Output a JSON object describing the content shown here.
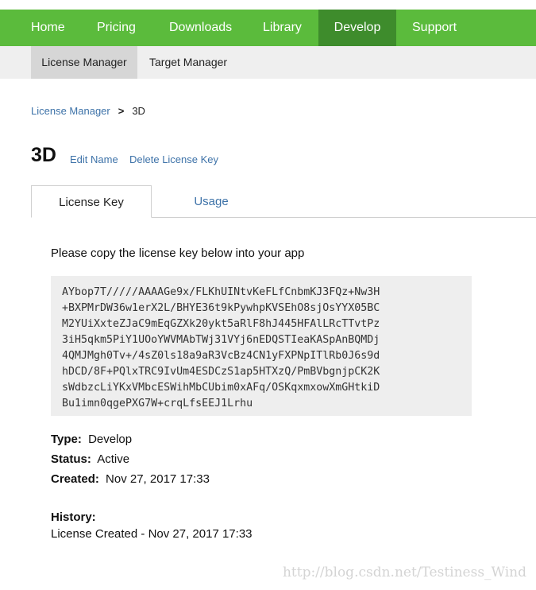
{
  "top_nav": {
    "items": [
      "Home",
      "Pricing",
      "Downloads",
      "Library",
      "Develop",
      "Support"
    ],
    "active": "Develop"
  },
  "sub_nav": {
    "items": [
      "License Manager",
      "Target Manager"
    ],
    "active": "License Manager"
  },
  "breadcrumb": {
    "parent": "License Manager",
    "separator": ">",
    "current": "3D"
  },
  "license": {
    "name": "3D",
    "edit_label": "Edit Name",
    "delete_label": "Delete License Key"
  },
  "tabs": [
    "License Key",
    "Usage"
  ],
  "key_section": {
    "instruction": "Please copy the license key below into your app",
    "key_lines": [
      "AYbop7T/////AAAAGe9x/FLKhUINtvKeFLfCnbmKJ3FQz+Nw3H",
      "+BXPMrDW36w1erX2L/BHYE36t9kPywhpKVSEhO8sjOsYYX05BC",
      "M2YUiXxteZJaC9mEqGZXk20ykt5aRlF8hJ445HFAlLRcTTvtPz",
      "3iH5qkm5PiY1UOoYWVMAbTWj31VYj6nEDQSTIeaKASpAnBQMDj",
      "4QMJMgh0Tv+/4sZ0ls18a9aR3VcBz4CN1yFXPNpITlRb0J6s9d",
      "hDCD/8F+PQlxTRC9IvUm4ESDCzS1ap5HTXzQ/PmBVbgnjpCK2K",
      "sWdbzcLiYKxVMbcESWihMbCUbim0xAFq/OSKqxmxowXmGHtkiD",
      "Bu1imn0qgePXG7W+crqLfsEEJ1Lrhu"
    ]
  },
  "details": {
    "type_label": "Type:",
    "type_value": "Develop",
    "status_label": "Status:",
    "status_value": "Active",
    "created_label": "Created:",
    "created_value": "Nov 27, 2017 17:33",
    "history_label": "History:",
    "history_entry": "License Created - Nov 27, 2017 17:33"
  },
  "watermark": "http://blog.csdn.net/Testiness_Wind",
  "colors": {
    "nav_green": "#5bbb3c",
    "nav_active": "#3e8c2c",
    "link_blue": "#3d72a8",
    "key_bg": "#eeeeee"
  }
}
